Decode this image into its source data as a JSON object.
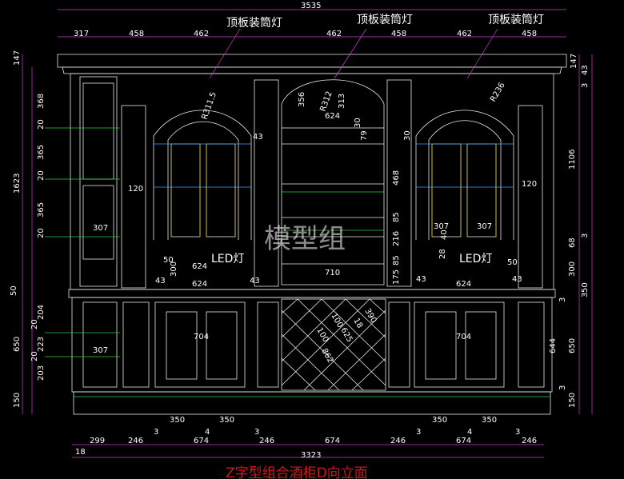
{
  "drawing": {
    "title": "Z字型组合酒柜D向立面",
    "watermark": "模型组",
    "callouts": [
      "顶板装筒灯",
      "顶板装筒灯",
      "顶板装筒灯"
    ],
    "led_labels": [
      "LED灯",
      "LED灯"
    ],
    "overall_width": "3535",
    "top_dims": [
      "317",
      "458",
      "462",
      "462",
      "458",
      "462",
      "458"
    ],
    "bottom_dims": [
      "299",
      "246",
      "674",
      "246",
      "674",
      "246",
      "674",
      "246"
    ],
    "bottom_total": "3323",
    "bottom_offset": "18",
    "door_dims": [
      "350",
      "350",
      "350",
      "350"
    ],
    "gap_marks": [
      "3",
      "4",
      "3",
      "3",
      "4",
      "3"
    ],
    "left_dims": [
      "147",
      "368",
      "20",
      "365",
      "20",
      "365",
      "20",
      "50",
      "204",
      "20",
      "223",
      "20",
      "203",
      "150"
    ],
    "left_totals": [
      "1623",
      "650"
    ],
    "right_dims": [
      "147",
      "43",
      "3",
      "1106",
      "3",
      "68",
      "300",
      "3",
      "50",
      "3",
      "644",
      "3",
      "150"
    ],
    "right_totals": [
      "650"
    ],
    "inner": {
      "arch_left_radius": "R311.5",
      "arch_right_radius": "R236",
      "arch_mid_radius": "R312",
      "arch_mid_h1": "356",
      "arch_mid_h2": "313",
      "arch_mid_width": "624",
      "mid_dims": [
        "30",
        "79",
        "30",
        "468",
        "85",
        "216",
        "85",
        "175"
      ],
      "shelf_width": "710",
      "side_mark": "120",
      "side_mark_r": "120",
      "small_43": "43",
      "shelf_307": "307",
      "led_624": "624",
      "led_50": "50",
      "led_300": "300",
      "led_40": "40",
      "led_28": "28",
      "lower_704": "704",
      "lattice_dims": [
        "390",
        "18",
        "100",
        "625",
        "862",
        "100"
      ]
    }
  }
}
